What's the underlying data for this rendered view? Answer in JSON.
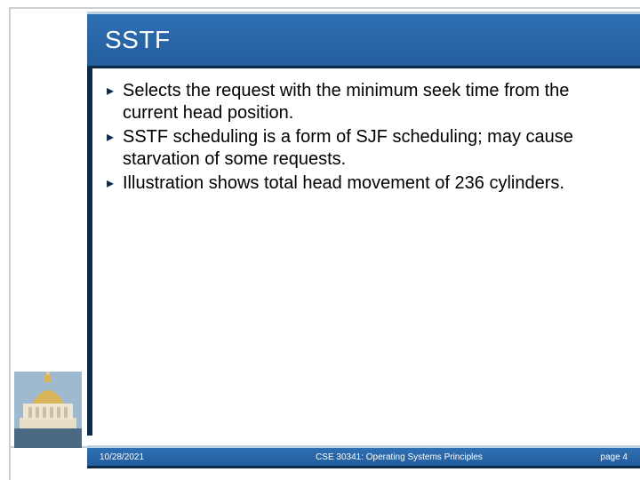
{
  "title": "SSTF",
  "bullets": [
    "Selects the request with the minimum seek time from the current head position.",
    "SSTF scheduling is a form of SJF scheduling; may cause starvation of some requests.",
    "Illustration shows total head movement of 236 cylinders."
  ],
  "footer": {
    "date": "10/28/2021",
    "course": "CSE 30341: Operating Systems Principles",
    "page": "page 4"
  },
  "colors": {
    "primary": "#2e6fb3",
    "dark": "#0d2a4a"
  }
}
